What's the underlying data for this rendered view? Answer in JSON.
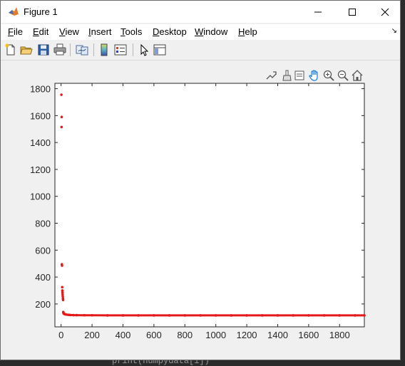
{
  "background": {
    "code_snippet": "print(numpydata[i])"
  },
  "window": {
    "title": "Figure 1"
  },
  "menu": [
    "File",
    "Edit",
    "View",
    "Insert",
    "Tools",
    "Desktop",
    "Window",
    "Help"
  ],
  "toolbar_icons": [
    "new-figure-icon",
    "open-file-icon",
    "save-icon",
    "print-icon",
    "link-plot-icon",
    "colorbar-icon",
    "legend-icon",
    "edit-plot-arrow-icon",
    "property-inspector-icon"
  ],
  "axes_toolbar_icons": [
    "export-icon",
    "brush-icon",
    "data-tips-icon",
    "pan-hand-icon",
    "zoom-in-icon",
    "zoom-out-icon",
    "restore-view-icon"
  ],
  "colors": {
    "marker": "#e41a1a",
    "window_bg": "#f0f0f0"
  },
  "chart_data": {
    "type": "scatter",
    "title": "",
    "xlabel": "",
    "ylabel": "",
    "xlim": [
      -40,
      1960
    ],
    "ylim": [
      30,
      1840
    ],
    "xticks": [
      0,
      200,
      400,
      600,
      800,
      1000,
      1200,
      1400,
      1600,
      1800
    ],
    "yticks": [
      200,
      400,
      600,
      800,
      1000,
      1200,
      1400,
      1600,
      1800
    ],
    "grid": false,
    "marker_color": "#e41a1a",
    "series": [
      {
        "points": [
          [
            2,
            1755
          ],
          [
            4,
            1590
          ],
          [
            3,
            1515
          ],
          [
            5,
            495
          ],
          [
            6,
            485
          ],
          [
            7,
            325
          ],
          [
            8,
            300
          ],
          [
            9,
            285
          ],
          [
            10,
            270
          ],
          [
            11,
            255
          ],
          [
            12,
            240
          ],
          [
            13,
            230
          ],
          [
            14,
            140
          ],
          [
            15,
            135
          ],
          [
            16,
            132
          ],
          [
            18,
            128
          ],
          [
            20,
            126
          ],
          [
            25,
            124
          ],
          [
            30,
            122
          ],
          [
            40,
            120
          ],
          [
            50,
            119
          ],
          [
            60,
            118
          ],
          [
            80,
            117
          ],
          [
            100,
            117
          ],
          [
            150,
            116
          ],
          [
            200,
            116
          ],
          [
            300,
            115
          ],
          [
            400,
            115
          ],
          [
            500,
            115
          ],
          [
            600,
            115
          ],
          [
            700,
            115
          ],
          [
            800,
            115
          ],
          [
            900,
            115
          ],
          [
            1000,
            115
          ],
          [
            1100,
            115
          ],
          [
            1200,
            115
          ],
          [
            1300,
            115
          ],
          [
            1400,
            115
          ],
          [
            1500,
            115
          ],
          [
            1600,
            115
          ],
          [
            1700,
            115
          ],
          [
            1800,
            115
          ],
          [
            1900,
            115
          ],
          [
            1960,
            115
          ]
        ]
      }
    ]
  }
}
